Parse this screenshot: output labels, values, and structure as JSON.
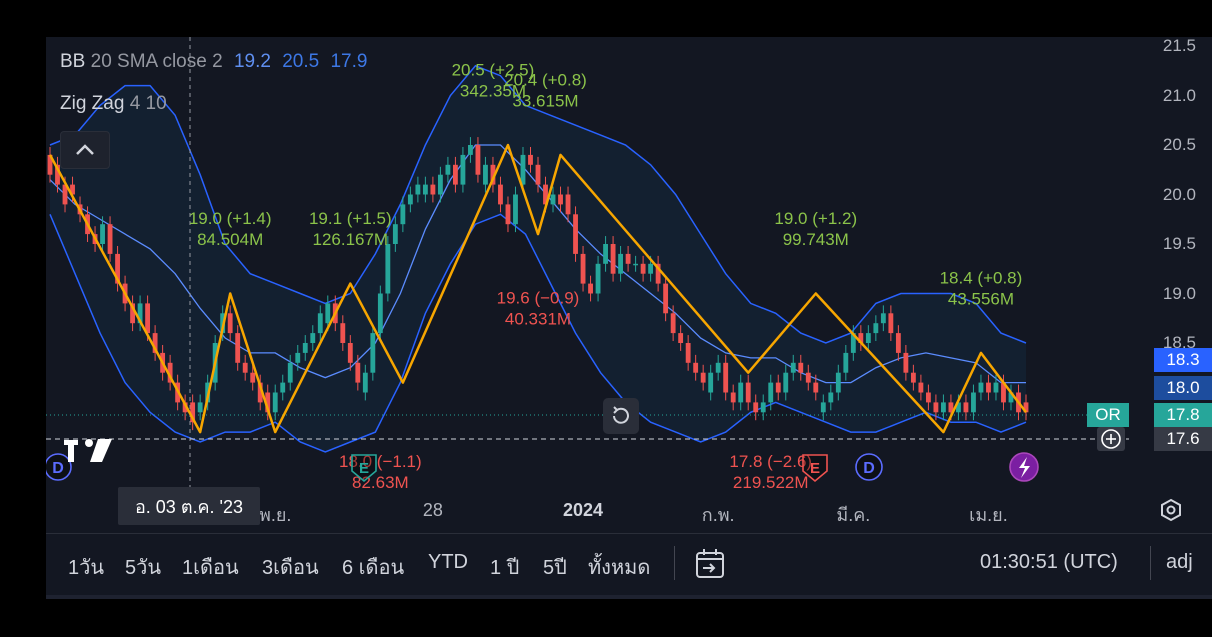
{
  "legend": {
    "bb": {
      "name": "BB",
      "params": "20 SMA close 2",
      "basis": "19.2",
      "upper": "20.5",
      "lower": "17.9"
    },
    "zigzag": {
      "name": "Zig Zag",
      "params": "4 10"
    }
  },
  "price_tags": {
    "bb_upper": "18.3",
    "bb_basis": "18.0",
    "last": "17.8",
    "or_label": "OR",
    "crosshair": "17.6"
  },
  "time_axis": {
    "crosshair_date": "อ. 03 ต.ค. '23"
  },
  "toolbar": {
    "ranges": [
      "1วัน",
      "5วัน",
      "1เดือน",
      "3เดือน",
      "6 เดือน",
      "YTD",
      "1 ปี",
      "5ปี",
      "ทั้งหมด"
    ],
    "clock": "01:30:51 (UTC)",
    "adj": "adj"
  },
  "colors": {
    "up": "#26a69a",
    "down": "#ef5350",
    "zigzag": "#f7a600",
    "bb_band": "#2962ff",
    "bb_basis": "#5b8cff",
    "label_green": "#8bc34a",
    "label_red": "#ef5350",
    "background": "#131722"
  },
  "icons": [
    "chevron-up-icon",
    "reset-icon",
    "plus-circle-icon",
    "settings-icon",
    "calendar-goto-icon",
    "tradingview-logo",
    "earnings-marker-icon",
    "dividend-marker-icon",
    "split-marker-icon"
  ],
  "chart_data": {
    "type": "candlestick",
    "title": "",
    "ylim": [
      17.5,
      21.5
    ],
    "y_ticks": [
      "18.5",
      "19.0",
      "19.5",
      "20.0",
      "20.5",
      "21.0",
      "21.5"
    ],
    "x_ticks": [
      "พ.ย.",
      "28",
      "2024",
      "ก.พ.",
      "มี.ค.",
      "เม.ย."
    ],
    "x_tick_index": [
      39,
      67,
      93,
      117,
      140,
      164
    ],
    "close": [
      20.2,
      20.1,
      19.9,
      20.0,
      19.8,
      19.6,
      19.5,
      19.7,
      19.4,
      19.1,
      18.9,
      18.7,
      18.9,
      18.6,
      18.4,
      18.2,
      18.1,
      17.9,
      17.8,
      17.7,
      17.9,
      18.1,
      18.5,
      18.8,
      18.6,
      18.3,
      18.2,
      18.1,
      17.9,
      17.8,
      18.0,
      18.1,
      18.3,
      18.4,
      18.5,
      18.6,
      18.8,
      18.9,
      18.7,
      18.5,
      18.3,
      18.1,
      18.2,
      18.6,
      19.0,
      19.5,
      19.7,
      19.9,
      20.0,
      20.1,
      20.1,
      20.0,
      20.2,
      20.3,
      20.1,
      20.4,
      20.5,
      20.2,
      20.3,
      20.1,
      19.9,
      19.7,
      20.0,
      20.4,
      20.3,
      20.1,
      19.9,
      20.0,
      19.9,
      19.8,
      19.4,
      19.1,
      19.0,
      19.3,
      19.5,
      19.2,
      19.4,
      19.3,
      19.3,
      19.2,
      19.3,
      19.1,
      18.8,
      18.6,
      18.5,
      18.3,
      18.2,
      18.1,
      18.2,
      18.3,
      18.0,
      17.9,
      18.1,
      17.9,
      17.8,
      17.9,
      18.1,
      18.0,
      18.2,
      18.3,
      18.2,
      18.1,
      18.0,
      17.9,
      18.0,
      18.2,
      18.4,
      18.6,
      18.5,
      18.6,
      18.7,
      18.8,
      18.6,
      18.4,
      18.2,
      18.1,
      18.0,
      17.9,
      17.8,
      17.9,
      17.8,
      17.9,
      17.8,
      18.0,
      18.1,
      18.0,
      18.1,
      17.9,
      18.0,
      17.8,
      17.8
    ],
    "open": [
      20.4,
      20.3,
      20.1,
      20.1,
      19.9,
      19.8,
      19.6,
      19.5,
      19.7,
      19.4,
      19.1,
      18.9,
      18.7,
      18.9,
      18.6,
      18.4,
      18.3,
      18.1,
      17.9,
      17.9,
      17.8,
      17.9,
      18.1,
      18.6,
      18.8,
      18.6,
      18.3,
      18.2,
      18.1,
      18.0,
      17.8,
      18.0,
      18.1,
      18.3,
      18.4,
      18.5,
      18.6,
      18.7,
      18.9,
      18.7,
      18.5,
      18.3,
      18.0,
      18.2,
      18.6,
      19.0,
      19.5,
      19.7,
      19.9,
      20.0,
      20.0,
      20.1,
      20.0,
      20.2,
      20.3,
      20.1,
      20.4,
      20.5,
      20.1,
      20.3,
      20.1,
      19.9,
      19.7,
      20.1,
      20.4,
      20.3,
      20.1,
      19.9,
      20.0,
      20.0,
      19.8,
      19.4,
      19.1,
      19.0,
      19.3,
      19.5,
      19.2,
      19.4,
      19.3,
      19.3,
      19.2,
      19.3,
      19.1,
      18.8,
      18.6,
      18.5,
      18.3,
      18.2,
      18.0,
      18.2,
      18.3,
      18.0,
      17.9,
      18.1,
      17.9,
      17.8,
      17.9,
      18.1,
      18.0,
      18.2,
      18.3,
      18.2,
      18.1,
      17.8,
      17.9,
      18.0,
      18.2,
      18.4,
      18.6,
      18.5,
      18.6,
      18.7,
      18.8,
      18.6,
      18.4,
      18.2,
      18.1,
      18.0,
      17.9,
      17.8,
      17.9,
      17.8,
      17.9,
      17.8,
      18.0,
      18.1,
      18.0,
      18.1,
      17.9,
      18.0,
      17.9
    ],
    "note_series": "sampled daily candles, Oct 2023 – Apr 2024",
    "zigzag": [
      [
        0,
        20.4
      ],
      [
        14,
        17.6
      ],
      [
        17,
        19.0
      ],
      [
        21,
        17.6
      ],
      [
        28,
        19.1
      ],
      [
        33,
        18.1
      ],
      [
        43,
        20.5
      ],
      [
        46,
        19.6
      ],
      [
        48,
        20.4
      ],
      [
        66,
        18.2
      ],
      [
        72,
        19.0
      ],
      [
        84,
        17.6
      ],
      [
        88,
        18.4
      ],
      [
        92,
        17.8
      ]
    ],
    "annotations": [
      {
        "text": "19.0 (+1.4)",
        "sub": "84.504M",
        "color": "green",
        "x": 17,
        "y": 19.7
      },
      {
        "text": "19.1 (+1.5)",
        "sub": "126.167M",
        "color": "green",
        "x": 28,
        "y": 19.7
      },
      {
        "text": "20.5 (+2.5)",
        "sub": "342.35M",
        "color": "green",
        "x": 42,
        "y": 21.2
      },
      {
        "text": "20.4 (+0.8)",
        "sub": "33.615M",
        "color": "green",
        "x": 47,
        "y": 21.1
      },
      {
        "text": "19.6 (−0.9)",
        "sub": "40.331M",
        "color": "red",
        "x": 46,
        "y": 18.9
      },
      {
        "text": "19.0 (+1.2)",
        "sub": "99.743M",
        "color": "green",
        "x": 72,
        "y": 19.7
      },
      {
        "text": "18.4 (+0.8)",
        "sub": "43.556M",
        "color": "green",
        "x": 88,
        "y": 19.1
      },
      {
        "text": "18.0 (−1.1)",
        "sub": "82.63M",
        "color": "red",
        "x": 31,
        "y": 17.25
      },
      {
        "text": "17.8 (−2.6)",
        "sub": "219.522M",
        "color": "red",
        "x": 68,
        "y": 17.25
      }
    ],
    "bands": {
      "upper": [
        20.5,
        20.6,
        20.9,
        21.1,
        21.1,
        20.8,
        20.2,
        19.5,
        19.2,
        19.1,
        19.0,
        18.9,
        19.0,
        19.4,
        19.9,
        20.5,
        21.0,
        21.3,
        21.2,
        20.9,
        20.8,
        20.7,
        20.6,
        20.5,
        20.3,
        20.0,
        19.6,
        19.2,
        18.9,
        18.8,
        18.6,
        18.5,
        18.6,
        18.9,
        19.0,
        19.0,
        19.0,
        18.9,
        18.6,
        18.5
      ],
      "lower": [
        19.8,
        19.2,
        18.6,
        18.1,
        17.8,
        17.6,
        17.5,
        17.6,
        17.6,
        17.7,
        17.5,
        17.4,
        17.5,
        17.6,
        18.1,
        18.8,
        19.3,
        19.7,
        19.8,
        19.6,
        19.1,
        18.6,
        18.2,
        17.9,
        17.7,
        17.6,
        17.5,
        17.6,
        17.8,
        17.9,
        17.8,
        17.7,
        17.6,
        17.6,
        17.7,
        17.8,
        17.7,
        17.7,
        17.6,
        17.7
      ]
    },
    "bb_upper_last": 18.3,
    "bb_basis_last": 18.0,
    "bb_lower_last": 17.7
  }
}
